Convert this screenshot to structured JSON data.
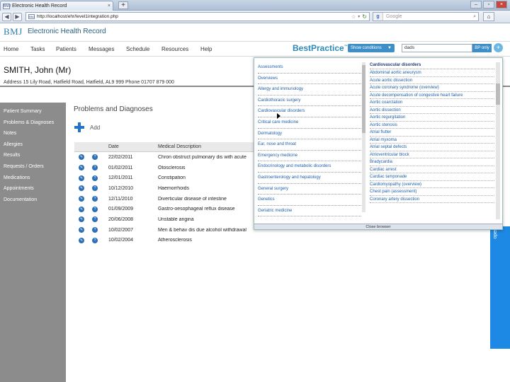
{
  "browser": {
    "tab_title": "Electronic Health Record",
    "tab_close": "×",
    "new_tab": "+",
    "url": "http://localhost/ehr/level1integration.php",
    "search_placeholder": "Google"
  },
  "app": {
    "logo": "BMJ",
    "title": "Electronic Health Record"
  },
  "menu": [
    "Home",
    "Tasks",
    "Patients",
    "Messages",
    "Schedule",
    "Resources",
    "Help"
  ],
  "bestpractice": {
    "logo": "BestPractice",
    "show_conditions_label": "Show conditions",
    "search_value": "dads",
    "bp_only_label": "BP only",
    "plus_label": "+",
    "close_label": "Close browser",
    "side_panel_label": "open",
    "categories": [
      "Assessments",
      "Overviews",
      "Allergy and immunology",
      "Cardiothoracic surgery",
      "Cardiovascular disorders",
      "Critical care medicine",
      "Dermatology",
      "Ear, nose and throat",
      "Emergency medicine",
      "Endocrinology and metabolic disorders",
      "Gastroenterology and hepatology",
      "General surgery",
      "Genetics",
      "Geriatric medicine"
    ],
    "conditions_header": "Cardiovascular disorders",
    "conditions": [
      "Abdominal aortic aneurysm",
      "Acute aortic dissection",
      "Acute coronary syndrome (overview)",
      "Acute decompensation of congestive heart failure",
      "Aortic coarctation",
      "Aortic dissection",
      "Aortic regurgitation",
      "Aortic stenosis",
      "Atrial flutter",
      "Atrial myxoma",
      "Atrial septal defects",
      "Atrioventricular block",
      "Bradycardia",
      "Cardiac arrest",
      "Cardiac tamponade",
      "Cardiomyopathy (overview)",
      "Chest pain (assessment)",
      "Coronary artery dissection"
    ]
  },
  "patient": {
    "name": "SMITH, John (Mr)",
    "address": "Address 15 Lily Road, Hatfield Road, Hatfield, AL9 999     Phone 01707 879 000"
  },
  "sidebar": [
    "Patient Summary",
    "Problems & Diagnoses",
    "Notes",
    "Allergies",
    "Results",
    "Requests / Orders",
    "Medications",
    "Appointments",
    "Documentation"
  ],
  "main": {
    "title": "Problems and Diagnoses",
    "add_label": "Add",
    "columns": [
      "Date",
      "Medical Description"
    ],
    "rows": [
      {
        "date": "22/02/2011",
        "desc": "Chron obstruct pulmonary dis with acute"
      },
      {
        "date": "01/02/2011",
        "desc": "Otosclerosis"
      },
      {
        "date": "12/01/2011",
        "desc": "Constipation"
      },
      {
        "date": "10/12/2010",
        "desc": "Haemorrhoids"
      },
      {
        "date": "12/11/2010",
        "desc": "Diverticular disease of intestine"
      },
      {
        "date": "01/09/2009",
        "desc": "Gastro-oesophageal reflux disease"
      },
      {
        "date": "20/06/2008",
        "desc": "Unstable angina"
      },
      {
        "date": "10/02/2007",
        "desc": "Men & behav dis due alcohol withdrawal"
      },
      {
        "date": "10/02/2004",
        "desc": "Atherosclerosis"
      }
    ]
  },
  "colors": {
    "accent": "#1e88e5",
    "sidebar_bg": "#8c8c8c",
    "link": "#1f5fa8"
  }
}
